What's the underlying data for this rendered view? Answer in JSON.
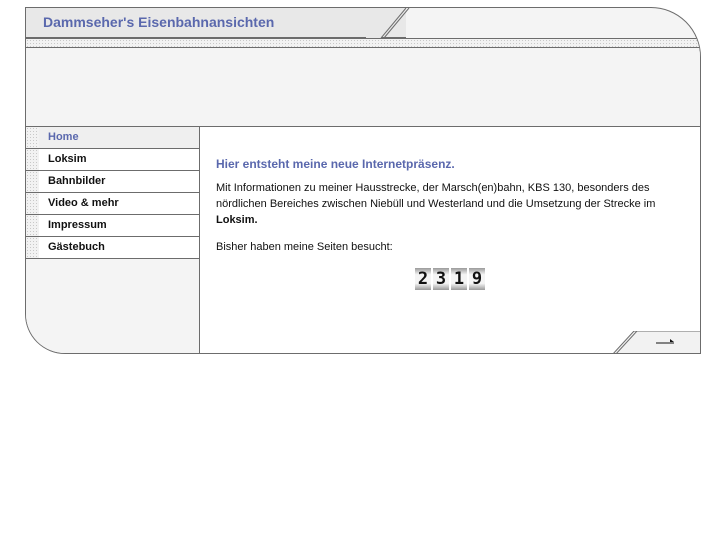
{
  "header": {
    "title": "Dammseher's Eisenbahnansichten"
  },
  "nav": {
    "items": [
      {
        "label": "Home"
      },
      {
        "label": "Loksim"
      },
      {
        "label": "Bahnbilder"
      },
      {
        "label": "Video & mehr"
      },
      {
        "label": "Impressum"
      },
      {
        "label": "Gästebuch"
      }
    ]
  },
  "main": {
    "headline": "Hier entsteht meine neue Internetpräsenz.",
    "intro": "Mit Informationen zu meiner Hausstrecke, der Marsch(en)bahn, KBS 130, besonders des nördlichen Bereiches zwischen Niebüll und Westerland und die Umsetzung der Strecke im",
    "intro_bold": "Loksim.",
    "visits_label": "Bisher haben meine Seiten besucht:",
    "counter_digits": [
      "2",
      "3",
      "1",
      "9"
    ]
  },
  "footer": {
    "next_icon": "arrow-right-icon"
  },
  "colors": {
    "accent": "#5a68ad",
    "border": "#6c6c6c"
  }
}
